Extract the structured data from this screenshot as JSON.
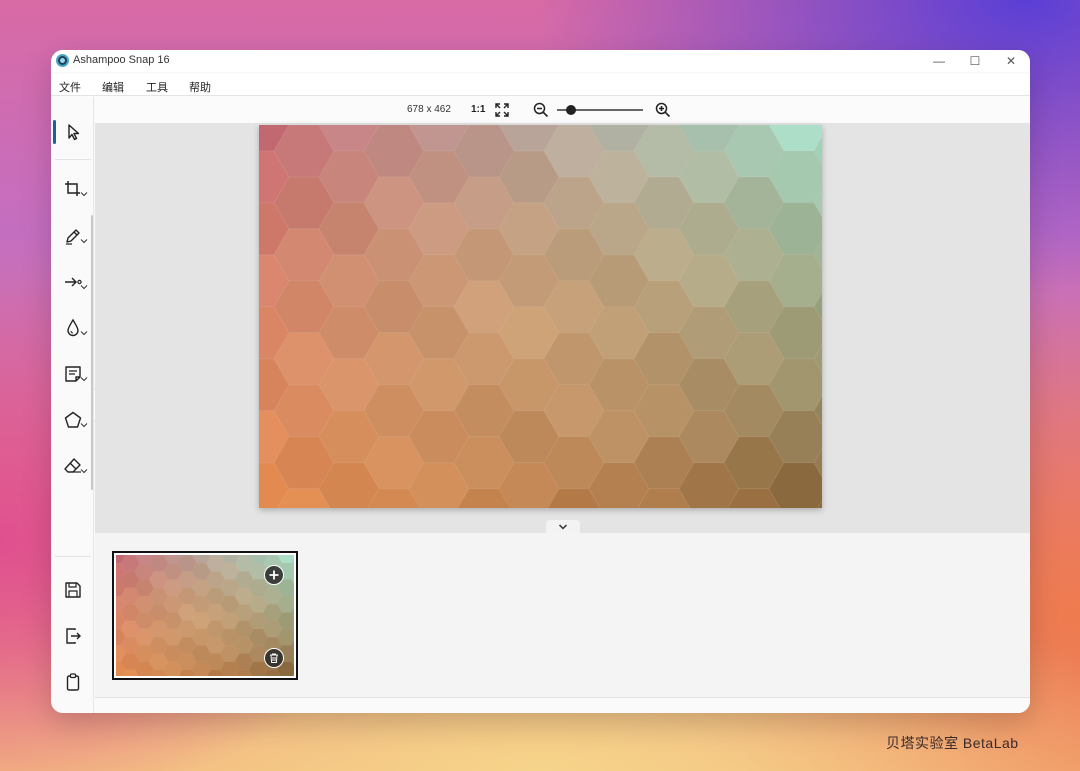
{
  "window": {
    "title": "Ashampoo Snap 16",
    "controls": {
      "minimize": "—",
      "maximize": "☐",
      "close": "✕"
    }
  },
  "menu": {
    "items": [
      {
        "label": "文件"
      },
      {
        "label": "编辑"
      },
      {
        "label": "工具"
      },
      {
        "label": "帮助"
      }
    ]
  },
  "toolbar": {
    "image_size": "678 x 462",
    "ratio_label": "1:1",
    "zoom_level_fraction": 0.12
  },
  "tools": [
    {
      "icon": "cursor-icon"
    },
    {
      "icon": "crop-icon"
    },
    {
      "icon": "pen-icon"
    },
    {
      "icon": "arrow-icon"
    },
    {
      "icon": "fill-icon"
    },
    {
      "icon": "text-box-icon"
    },
    {
      "icon": "shape-icon"
    },
    {
      "icon": "eraser-icon"
    },
    {
      "icon": "save-icon"
    },
    {
      "icon": "export-icon"
    },
    {
      "icon": "clipboard-icon"
    },
    {
      "icon": "trash-icon"
    }
  ],
  "colors": {
    "accent": "#1f5f96",
    "hex_palette": [
      "#c8707a",
      "#d9a28a",
      "#e7c09a",
      "#cfd7b4",
      "#a8dcc6",
      "#e68a5c",
      "#e6b46e",
      "#c7a667",
      "#9a8850",
      "#8c6a3e"
    ]
  },
  "watermark": "贝塔实验室 BetaLab"
}
